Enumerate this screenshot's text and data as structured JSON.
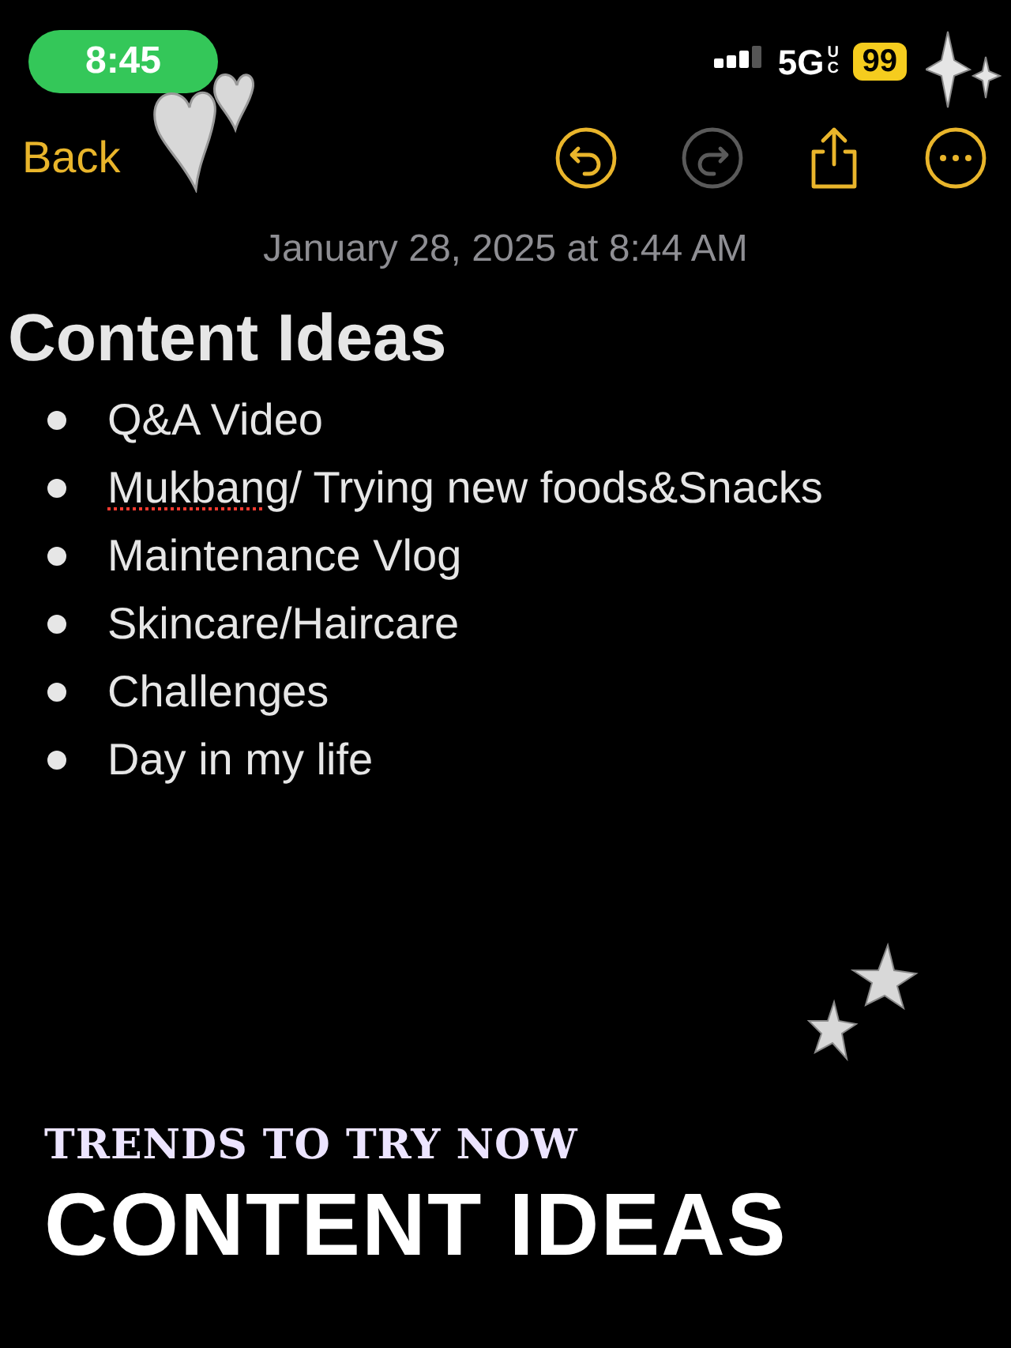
{
  "status_bar": {
    "time": "8:45",
    "network": "5G",
    "network_suffix": "UC",
    "battery": "99"
  },
  "toolbar": {
    "back": "Back",
    "buttons": [
      {
        "kind": "undo",
        "disabled": false
      },
      {
        "kind": "redo",
        "disabled": true
      },
      {
        "kind": "share",
        "disabled": false
      },
      {
        "kind": "more",
        "disabled": false
      }
    ]
  },
  "note": {
    "date": "January 28, 2025 at 8:44 AM",
    "title": "Content Ideas",
    "items": [
      {
        "parts": [
          {
            "text": "Q&A Video",
            "misspelled": false
          }
        ]
      },
      {
        "parts": [
          {
            "text": "Mukbang",
            "misspelled": true
          },
          {
            "text": "/ Trying new foods&Snacks",
            "misspelled": false
          }
        ]
      },
      {
        "parts": [
          {
            "text": "Maintenance Vlog",
            "misspelled": false
          }
        ]
      },
      {
        "parts": [
          {
            "text": "Skincare/Haircare",
            "misspelled": false
          }
        ]
      },
      {
        "parts": [
          {
            "text": "Challenges",
            "misspelled": false
          }
        ]
      },
      {
        "parts": [
          {
            "text": "Day in my life",
            "misspelled": false
          }
        ]
      }
    ]
  },
  "overlay": {
    "subtitle": "TRENDS TO TRY NOW",
    "headline": "CONTENT IDEAS"
  }
}
